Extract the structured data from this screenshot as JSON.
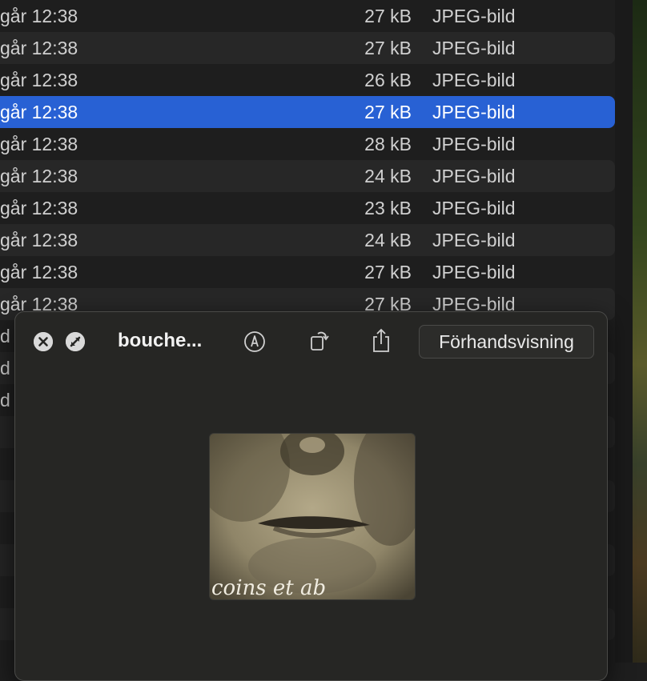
{
  "finder": {
    "rows": [
      {
        "date": "går 12:38",
        "size": "27 kB",
        "kind": "JPEG-bild"
      },
      {
        "date": "går 12:38",
        "size": "27 kB",
        "kind": "JPEG-bild"
      },
      {
        "date": "går 12:38",
        "size": "26 kB",
        "kind": "JPEG-bild"
      },
      {
        "date": "går 12:38",
        "size": "27 kB",
        "kind": "JPEG-bild"
      },
      {
        "date": "går 12:38",
        "size": "28 kB",
        "kind": "JPEG-bild"
      },
      {
        "date": "går 12:38",
        "size": "24 kB",
        "kind": "JPEG-bild"
      },
      {
        "date": "går 12:38",
        "size": "23 kB",
        "kind": "JPEG-bild"
      },
      {
        "date": "går 12:38",
        "size": "24 kB",
        "kind": "JPEG-bild"
      },
      {
        "date": "går 12:38",
        "size": "27 kB",
        "kind": "JPEG-bild"
      },
      {
        "date": "går 12:38",
        "size": "27 kB",
        "kind": "JPEG-bild"
      }
    ],
    "selected_index": 3,
    "partial_rows": [
      "d",
      "d",
      "d"
    ]
  },
  "quicklook": {
    "title": "bouche...",
    "open_with_label": "Förhandsvisning",
    "close_icon": "close-icon",
    "fullscreen_icon": "fullscreen-icon",
    "markup_icon": "markup-icon",
    "rotate_icon": "rotate-icon",
    "share_icon": "share-icon",
    "preview_caption": "coins et ab"
  },
  "colors": {
    "selection": "#2861d4",
    "panel": "#262624"
  }
}
